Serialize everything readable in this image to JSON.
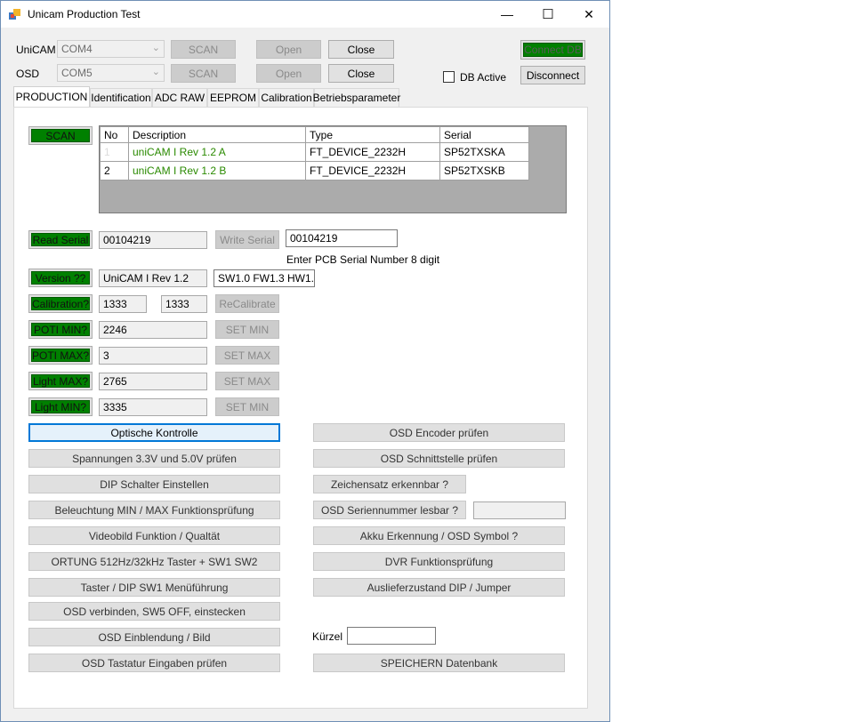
{
  "window": {
    "title": "Unicam Production Test",
    "minimize": "—",
    "maximize": "☐",
    "close": "✕"
  },
  "conn": {
    "unicam_label": "UniCAM",
    "unicam_port": "COM4",
    "osd_label": "OSD",
    "osd_port": "COM5",
    "scan": "SCAN",
    "open": "Open",
    "close": "Close",
    "connect_db": "Connect DB",
    "db_active": "DB Active",
    "disconnect": "Disconnect"
  },
  "tabs": [
    "PRODUCTION",
    "Identification",
    "ADC RAW",
    "EEPROM",
    "Calibration",
    "Betriebsparameter"
  ],
  "production": {
    "scan": "SCAN",
    "grid": {
      "headers": [
        "No",
        "Description",
        "Type",
        "Serial"
      ],
      "rows": [
        [
          "1",
          "uniCAM I Rev 1.2 A",
          "FT_DEVICE_2232H",
          "SP52TXSKA"
        ],
        [
          "2",
          "uniCAM I Rev 1.2 B",
          "FT_DEVICE_2232H",
          "SP52TXSKB"
        ]
      ]
    },
    "read_serial": "Read Serial",
    "serial_value": "00104219",
    "write_serial": "Write Serial",
    "serial_input": "00104219",
    "serial_hint": "Enter PCB Serial Number 8 digit",
    "version_btn": "Version ??",
    "version_value": "UniCAM I Rev 1.2",
    "fw_value": "SW1.0 FW1.3 HW1.2",
    "calib_btn": "Calibration?",
    "calib_a": "1333",
    "calib_b": "1333",
    "recalibrate": "ReCalibrate",
    "poti_min_btn": "POTI MIN?",
    "poti_min_val": "2246",
    "set_min": "SET MIN",
    "poti_max_btn": "POTI MAX?",
    "poti_max_val": "3",
    "set_max": "SET MAX",
    "light_max_btn": "Light MAX?",
    "light_max_val": "2765",
    "light_min_btn": "Light MIN?",
    "light_min_val": "3335",
    "left_tests": [
      "Optische Kontrolle",
      "Spannungen 3.3V und 5.0V prüfen",
      "DIP Schalter Einstellen",
      "Beleuchtung MIN / MAX Funktionsprüfung",
      "Videobild Funktion / Qualtät",
      "ORTUNG 512Hz/32kHz Taster + SW1 SW2",
      "Taster / DIP SW1 Menüführung",
      "OSD verbinden, SW5 OFF, einstecken",
      "OSD Einblendung / Bild",
      "OSD Tastatur Eingaben prüfen"
    ],
    "right_tests": {
      "osd_encoder": "OSD Encoder prüfen",
      "osd_interface": "OSD Schnittstelle prüfen",
      "charset": "Zeichensatz erkennbar ?",
      "osd_serial": "OSD Seriennummer lesbar ?",
      "akku": "Akku Erkennung / OSD Symbol ?",
      "dvr": "DVR Funktionsprüfung",
      "delivery": "Auslieferzustand DIP / Jumper"
    },
    "kuerzel_label": "Kürzel",
    "save_db": "SPEICHERN Datenbank"
  }
}
